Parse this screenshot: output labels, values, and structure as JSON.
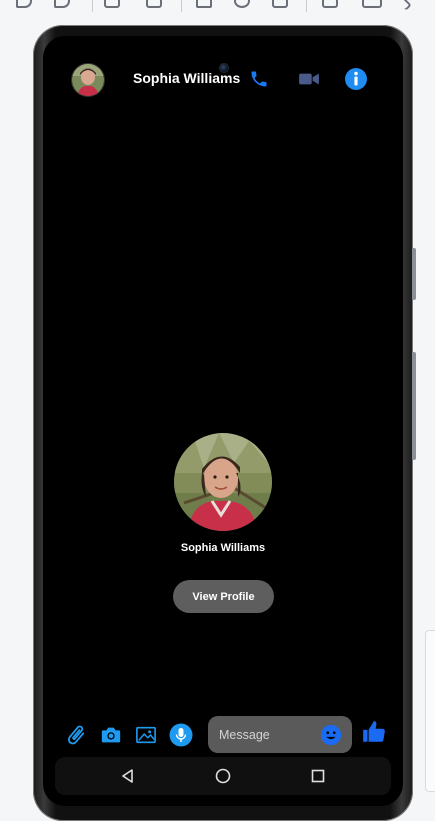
{
  "contact": {
    "name": "Sophia Williams"
  },
  "header": {
    "title": "Sophia Williams",
    "icons": [
      "avatar",
      "phone-icon",
      "video-camera-icon",
      "info-icon"
    ]
  },
  "profile": {
    "name": "Sophia Williams",
    "view_profile_label": "View Profile"
  },
  "composer": {
    "placeholder": "Message",
    "icons": [
      "attachment-icon",
      "camera-icon",
      "image-icon",
      "microphone-icon",
      "emoji-icon",
      "thumbs-up-icon"
    ]
  },
  "nav": {
    "icons": [
      "back-icon",
      "home-icon",
      "recents-icon"
    ]
  },
  "colors": {
    "accent": "#1a78f2",
    "icon_blue": "#1e9bf0",
    "background": "#000000",
    "button_gray": "#5e5e5e"
  }
}
